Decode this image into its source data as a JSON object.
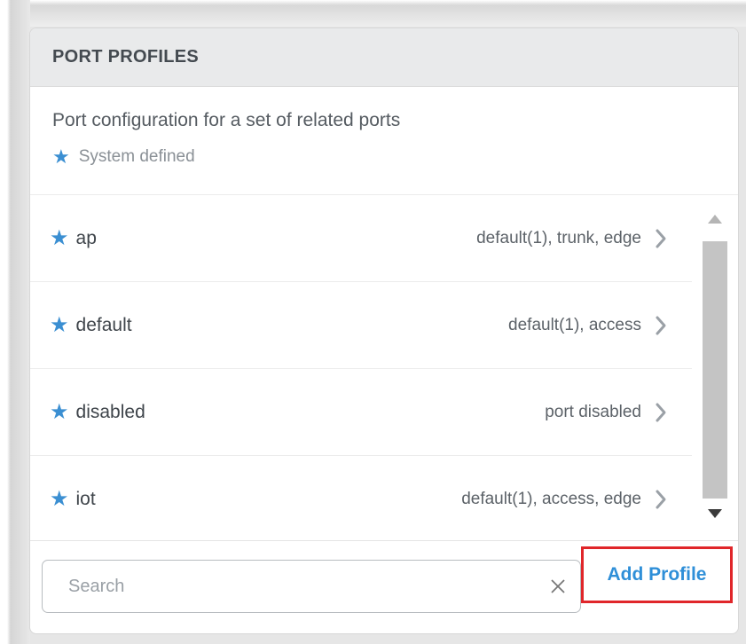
{
  "panel": {
    "title": "PORT PROFILES",
    "description": "Port configuration for a set of related ports",
    "legend_symbol": "★",
    "legend_label": "System defined"
  },
  "profiles": [
    {
      "name": "ap",
      "detail": "default(1), trunk, edge",
      "system_defined": true
    },
    {
      "name": "default",
      "detail": "default(1), access",
      "system_defined": true
    },
    {
      "name": "disabled",
      "detail": "port disabled",
      "system_defined": true
    },
    {
      "name": "iot",
      "detail": "default(1), access, edge",
      "system_defined": true
    }
  ],
  "search": {
    "placeholder": "Search",
    "value": ""
  },
  "actions": {
    "add_profile_label": "Add Profile"
  },
  "icons": {
    "star": "star-icon",
    "row_chevron": "chevron-right-icon",
    "clear": "close-icon",
    "scroll_up": "triangle-up-icon",
    "scroll_down": "triangle-down-icon"
  },
  "colors": {
    "accent": "#2f8fd8",
    "star": "#3b8fd2",
    "highlight_border": "#e0262a",
    "header_bg": "#e9eaeb",
    "scroll_thumb": "#c4c4c4"
  }
}
